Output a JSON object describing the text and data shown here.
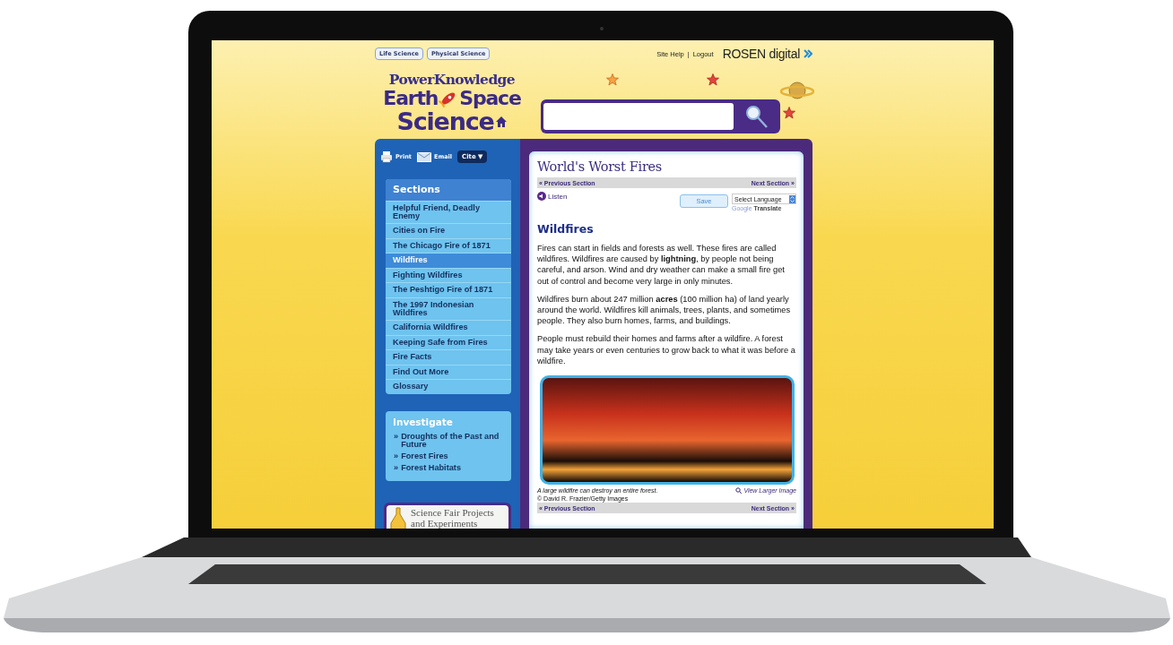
{
  "top_links": [
    {
      "label": "Life Science"
    },
    {
      "label": "Physical Science"
    }
  ],
  "utility_links": {
    "help": "Site Help",
    "separator": "|",
    "logout": "Logout"
  },
  "brand": {
    "name": "ROSEN digital"
  },
  "logo": {
    "line_1": "PowerKnowledge",
    "line_2a": "Earth",
    "line_2b": "Space",
    "line_3": "Science"
  },
  "tools": [
    {
      "kind": "print",
      "label": "Print"
    },
    {
      "kind": "email",
      "label": "Email"
    },
    {
      "kind": "dropdown",
      "label": "Cite ▼"
    }
  ],
  "sections": {
    "title": "Sections",
    "items": [
      {
        "label": "Helpful Friend, Deadly Enemy",
        "selected": false
      },
      {
        "label": "Cities on Fire",
        "selected": false
      },
      {
        "label": "The Chicago Fire of 1871",
        "selected": false
      },
      {
        "label": "Wildfires",
        "selected": true
      },
      {
        "label": "Fighting Wildfires",
        "selected": false
      },
      {
        "label": "The Peshtigo Fire of 1871",
        "selected": false
      },
      {
        "label": "The 1997 Indonesian Wildfires",
        "selected": false
      },
      {
        "label": "California Wildfires",
        "selected": false
      },
      {
        "label": "Keeping Safe from Fires",
        "selected": false
      },
      {
        "label": "Fire Facts",
        "selected": false
      },
      {
        "label": "Find Out More",
        "selected": false
      },
      {
        "label": "Glossary",
        "selected": false
      }
    ]
  },
  "investigate": {
    "title": "Investigate",
    "items": [
      {
        "bullet": "»",
        "label": "Droughts of the Past and Future"
      },
      {
        "bullet": "»",
        "label": "Forest Fires"
      },
      {
        "bullet": "»",
        "label": "Forest Habitats"
      }
    ]
  },
  "promo": {
    "label": "Science Fair Projects and Experiments"
  },
  "article": {
    "title": "World's Worst Fires",
    "nav_top": {
      "previous": "« Previous Section",
      "next": "Next Section »"
    },
    "listen": "Listen",
    "save": "Save",
    "language_select": "Select Language",
    "translate_brand": "Google",
    "translate": "Translate",
    "heading": "Wildfires",
    "paragraphs": [
      "Fires can start in fields and forests as well. These fires are called wildfires. Wildfires are caused by **lightning**, by people not being careful, and arson. Wind and dry weather can make a small fire get out of control and become very large in only minutes.",
      "Wildfires burn about 247 million **acres** (100 million ha) of land yearly around the world. Wildfires kill animals, trees, plants, and sometimes people. They also burn homes, farms, and buildings.",
      "People must rebuild their homes and farms after a wildfire. A forest may take years or even centuries to grow back to what it was before a wildfire."
    ],
    "image": {
      "caption": "A large wildfire can destroy an entire forest.",
      "credit": "© David R. Frazier/Getty Images",
      "view_larger": "View Larger Image"
    },
    "nav_bottom": {
      "previous": "« Previous Section",
      "next": "Next Section »"
    }
  }
}
